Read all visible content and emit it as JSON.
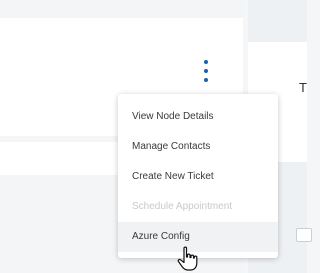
{
  "menu": {
    "items": [
      {
        "label": "View Node Details",
        "disabled": false
      },
      {
        "label": "Manage Contacts",
        "disabled": false
      },
      {
        "label": "Create New Ticket",
        "disabled": false
      },
      {
        "label": "Schedule Appointment",
        "disabled": true
      },
      {
        "label": "Azure Config",
        "disabled": false,
        "hovered": true
      }
    ]
  },
  "right_panel": {
    "partial_letter": "T"
  },
  "colors": {
    "accent": "#1f5fa8",
    "hover_bg": "#f0f2f4",
    "disabled_text": "#c9c9c9"
  },
  "icons": {
    "more": "kebab-menu-icon",
    "pointer": "hand-cursor-icon"
  }
}
